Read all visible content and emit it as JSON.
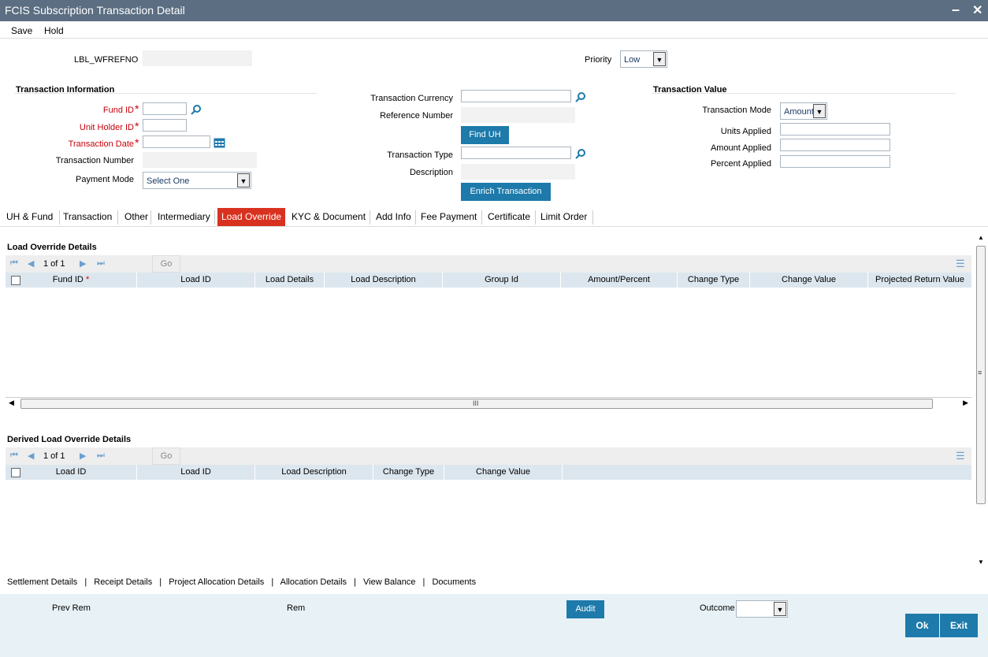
{
  "window": {
    "title": "FCIS Subscription Transaction Detail",
    "minimize": "–",
    "close": "✕"
  },
  "menu": {
    "save": "Save",
    "hold": "Hold"
  },
  "header": {
    "wfrefno_label": "LBL_WFREFNO",
    "priority_label": "Priority",
    "priority_value": "Low"
  },
  "transaction_information": {
    "title": "Transaction Information",
    "fund_id": "Fund ID",
    "unit_holder_id": "Unit Holder ID",
    "transaction_date": "Transaction Date",
    "transaction_number": "Transaction Number",
    "payment_mode": "Payment Mode",
    "payment_mode_value": "Select One"
  },
  "middle": {
    "transaction_currency": "Transaction Currency",
    "reference_number": "Reference Number",
    "find_uh": "Find UH",
    "transaction_type": "Transaction Type",
    "description": "Description",
    "enrich_transaction": "Enrich Transaction"
  },
  "transaction_value": {
    "title": "Transaction Value",
    "transaction_mode": "Transaction Mode",
    "transaction_mode_value": "Amount",
    "units_applied": "Units Applied",
    "amount_applied": "Amount Applied",
    "percent_applied": "Percent Applied"
  },
  "tabs": [
    "UH & Fund",
    "Transaction",
    "Other",
    "Intermediary",
    "Load Override",
    "KYC & Document",
    "Add Info",
    "Fee Payment",
    "Certificate",
    "Limit Order"
  ],
  "load_override": {
    "title": "Load Override Details",
    "page_text": "1 of 1",
    "go": "Go",
    "columns": [
      "Fund ID",
      "Load ID",
      "Load Details",
      "Load Description",
      "Group Id",
      "Amount/Percent",
      "Change Type",
      "Change Value",
      "Projected Return Value"
    ],
    "scroll_mark": "III"
  },
  "derived": {
    "title": "Derived Load Override Details",
    "page_text": "1 of 1",
    "go": "Go",
    "columns": [
      "Load ID",
      "Load ID",
      "Load Description",
      "Change Type",
      "Change Value"
    ]
  },
  "footer_links": [
    "Settlement Details",
    "Receipt Details",
    "Project Allocation Details",
    "Allocation Details",
    "View Balance",
    "Documents"
  ],
  "footer_sep": "|",
  "bottom": {
    "prev_rem": "Prev Rem",
    "rem": "Rem",
    "audit": "Audit",
    "outcome": "Outcome",
    "ok": "Ok",
    "exit": "Exit"
  },
  "colors": {
    "titlebar": "#5b6e82",
    "button": "#1d7aaa",
    "active_tab": "#d9311f",
    "required": "#c8000a",
    "grid_header": "#dce6ee",
    "bottom_bar": "#e8f2f6"
  }
}
